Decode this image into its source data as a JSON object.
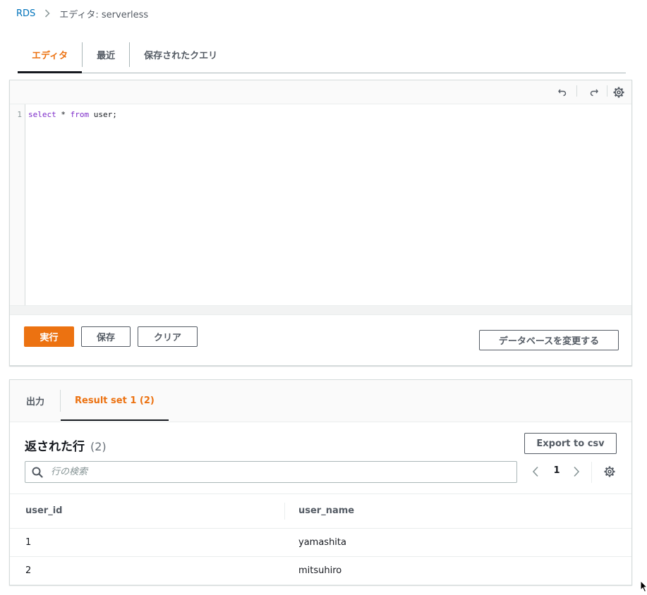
{
  "breadcrumb": {
    "root": "RDS",
    "current": "エディタ: serverless"
  },
  "top_tabs": [
    {
      "label": "エディタ",
      "active": true
    },
    {
      "label": "最近",
      "active": false
    },
    {
      "label": "保存されたクエリ",
      "active": false
    }
  ],
  "editor": {
    "toolbar_icons": [
      "undo-icon",
      "redo-icon",
      "gear-icon"
    ],
    "line_number": "1",
    "code": {
      "kw1": "select",
      "mid": " * ",
      "kw2": "from",
      "rest": " user;"
    }
  },
  "actions": {
    "run": "実行",
    "save": "保存",
    "clear": "クリア",
    "change_db": "データベースを変更する"
  },
  "results": {
    "tabs": [
      {
        "label": "出力",
        "active": false
      },
      {
        "label": "Result set 1 (2)",
        "active": true
      }
    ],
    "title": "返された行",
    "count": "(2)",
    "export": "Export to csv",
    "search_placeholder": "行の検索",
    "page": "1",
    "columns": [
      "user_id",
      "user_name"
    ],
    "rows": [
      [
        "1",
        "yamashita"
      ],
      [
        "2",
        "mitsuhiro"
      ]
    ]
  },
  "colors": {
    "accent": "#ec7211",
    "link": "#0073bb",
    "keyword": "#7c29c9",
    "text": "#16191f",
    "muted": "#545b64"
  }
}
